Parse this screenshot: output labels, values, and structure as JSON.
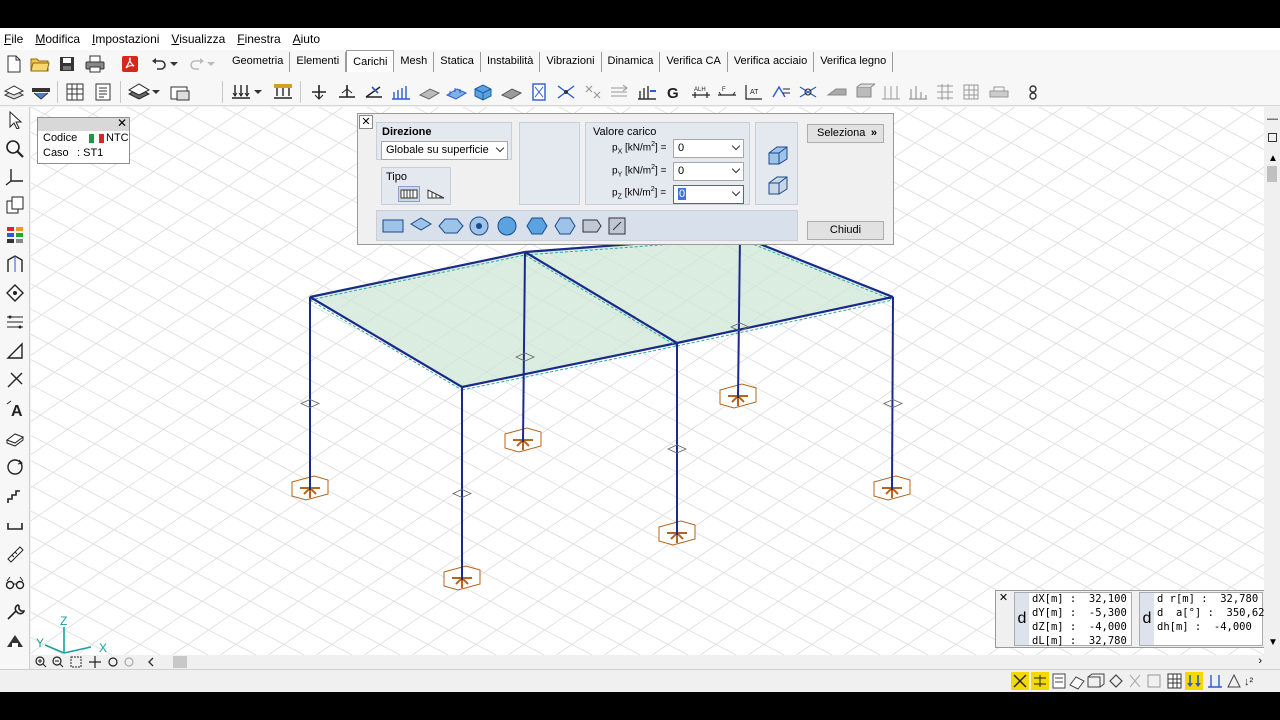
{
  "menu": [
    "File",
    "Modifica",
    "Impostazioni",
    "Visualizza",
    "Finestra",
    "Aiuto"
  ],
  "tabs": [
    {
      "label": "Geometria",
      "active": false
    },
    {
      "label": "Elementi",
      "active": false
    },
    {
      "label": "Carichi",
      "active": true
    },
    {
      "label": "Mesh",
      "active": false
    },
    {
      "label": "Statica",
      "active": false
    },
    {
      "label": "Instabilità",
      "active": false
    },
    {
      "label": "Vibrazioni",
      "active": false
    },
    {
      "label": "Dinamica",
      "active": false
    },
    {
      "label": "Verifica CA",
      "active": false
    },
    {
      "label": "Verifica acciaio",
      "active": false
    },
    {
      "label": "Verifica legno",
      "active": false
    }
  ],
  "code_panel": {
    "codice_label": "Codice",
    "codice_value": "NTC",
    "caso_label": "Caso",
    "caso_value": ": ST1"
  },
  "load_dialog": {
    "direzione_label": "Direzione",
    "direzione_value": "Globale su superficie",
    "tipo_label": "Tipo",
    "valore_label": "Valore carico",
    "px_label": "p",
    "px_sub": "X",
    "py_label": "p",
    "py_sub": "Y",
    "pz_label": "p",
    "pz_sub": "Z",
    "unit_pre": "[kN/m",
    "unit_exp": "2",
    "unit_post": "] =",
    "px_value": "0",
    "py_value": "0",
    "pz_value": "0",
    "seleziona_label": "Seleziona",
    "chiudi_label": "Chiudi"
  },
  "measure": {
    "dx": "dX[m] :  32,100",
    "dy": "dY[m] :  -5,300",
    "dz": "dZ[m] :  -4,000",
    "dl": "dL[m] :  32,780",
    "dr": "d r[m] :  32,780",
    "da": "d  a[°] :  350,62",
    "dh": "dh[m] :  -4,000",
    "d1": "d",
    "d2": "d"
  },
  "axis": {
    "x": "X",
    "y": "Y",
    "z": "Z"
  },
  "colors": {
    "slab_fill": "#cfe7d6",
    "frame_line": "#1a2a8a",
    "support": "#b5651d",
    "grid": "#dcdcdc"
  }
}
